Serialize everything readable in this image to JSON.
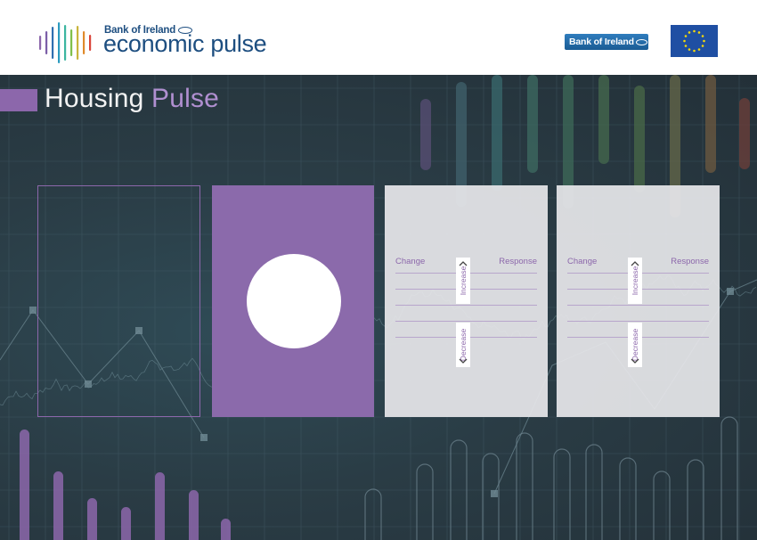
{
  "header": {
    "logo_bank_text": "Bank of Ireland",
    "logo_product_text": "economic pulse",
    "badge_text": "Bank of Ireland",
    "logo_bar_colors": [
      "#8c67ab",
      "#7b5ea7",
      "#2f6fb0",
      "#2c9bc0",
      "#3bb5a0",
      "#7fbf4a",
      "#c9b43c",
      "#e08a2c",
      "#d9453a"
    ],
    "flag_colors": {
      "background": "#1f4fa3",
      "stars": "#f5d90a"
    }
  },
  "page": {
    "title_word1": "Housing",
    "title_word2": "Pulse",
    "accent_color": "#8c67ab"
  },
  "scales": [
    {
      "left_label": "Change",
      "right_label": "Response",
      "up_label": "Increase",
      "down_label": "Decrease"
    },
    {
      "left_label": "Change",
      "right_label": "Response",
      "up_label": "Increase",
      "down_label": "Decrease"
    }
  ]
}
